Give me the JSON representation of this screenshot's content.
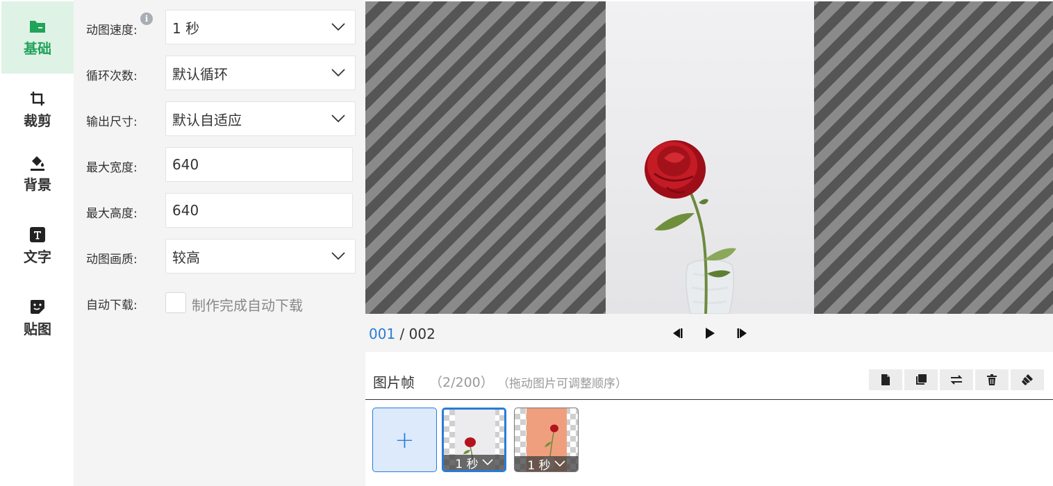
{
  "sidebar": {
    "items": [
      {
        "label": "基础",
        "icon": "folder-icon",
        "active": true
      },
      {
        "label": "裁剪",
        "icon": "crop-icon",
        "active": false
      },
      {
        "label": "背景",
        "icon": "paint-bucket-icon",
        "active": false
      },
      {
        "label": "文字",
        "icon": "text-icon",
        "active": false
      },
      {
        "label": "贴图",
        "icon": "sticker-icon",
        "active": false
      }
    ]
  },
  "settings": {
    "speed_label": "动图速度:",
    "speed_value": "1 秒",
    "loop_label": "循环次数:",
    "loop_value": "默认循环",
    "size_label": "输出尺寸:",
    "size_value": "默认自适应",
    "max_width_label": "最大宽度:",
    "max_width_value": "640",
    "max_height_label": "最大高度:",
    "max_height_value": "640",
    "quality_label": "动图画质:",
    "quality_value": "较高",
    "auto_download_label": "自动下载:",
    "auto_download_text": "制作完成自动下载",
    "info_glyph": "i"
  },
  "preview": {
    "current": "001",
    "separator": " / ",
    "total": "002"
  },
  "frames": {
    "title": "图片帧",
    "count": "（2/200）",
    "hint": "（拖动图片可调整顺序）",
    "add_symbol": "+",
    "items": [
      {
        "duration": "1 秒",
        "selected": true
      },
      {
        "duration": "1 秒",
        "selected": false
      }
    ]
  },
  "colors": {
    "accent_green": "#22a35a",
    "accent_blue": "#2a7bd6"
  }
}
